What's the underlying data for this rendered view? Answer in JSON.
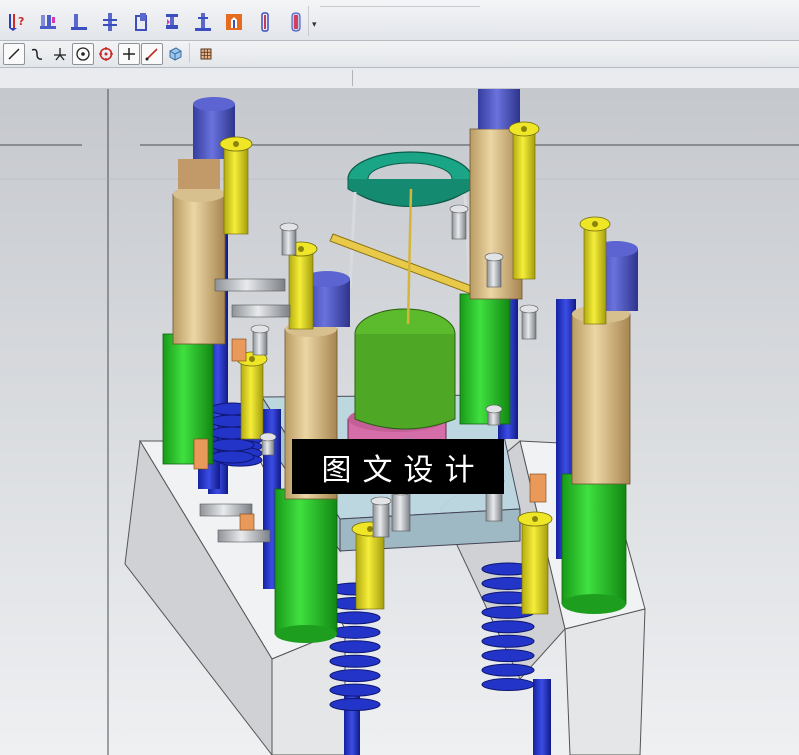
{
  "toolbar_top": {
    "buttons": [
      {
        "name": "analysis-query-icon",
        "color": "#d12c2c"
      },
      {
        "name": "column-layout-icon",
        "color": "#4a5cc7"
      },
      {
        "name": "l-bracket-icon",
        "color": "#3c4fbf"
      },
      {
        "name": "h-stack-icon",
        "color": "#3c4fbf"
      },
      {
        "name": "offset-block-icon",
        "color": "#3c4fbf"
      },
      {
        "name": "clamp-icon",
        "color": "#3c4fbf"
      },
      {
        "name": "post-icon",
        "color": "#3c4fbf"
      },
      {
        "name": "orange-block-icon",
        "color": "#e66a1f"
      },
      {
        "name": "thin-pin-icon",
        "color": "#c43a5e"
      },
      {
        "name": "red-pin-icon",
        "color": "#d43f5c"
      }
    ],
    "overflow_glyph": "▾"
  },
  "toolbar_bottom": {
    "buttons": [
      {
        "name": "line-tool-icon"
      },
      {
        "name": "curve-tool-icon"
      },
      {
        "name": "branch-tool-icon"
      },
      {
        "name": "circle-center-icon"
      },
      {
        "name": "point-target-icon"
      },
      {
        "name": "crosshair-icon"
      },
      {
        "name": "diagonal-line-icon"
      },
      {
        "name": "view-cube-icon"
      },
      {
        "name": "grid-icon"
      }
    ]
  },
  "watermark": {
    "text": "图文设计"
  },
  "colors": {
    "spring_blue": "#2334c9",
    "rod_yellow": "#e8df17",
    "cylinder_green": "#29c429",
    "cylinder_tan": "#dcc08a",
    "cap_purple": "#4d55c2",
    "ring_teal": "#1aa587",
    "base_gray": "#e7e8ea",
    "cup_pink": "#d56ea8"
  }
}
